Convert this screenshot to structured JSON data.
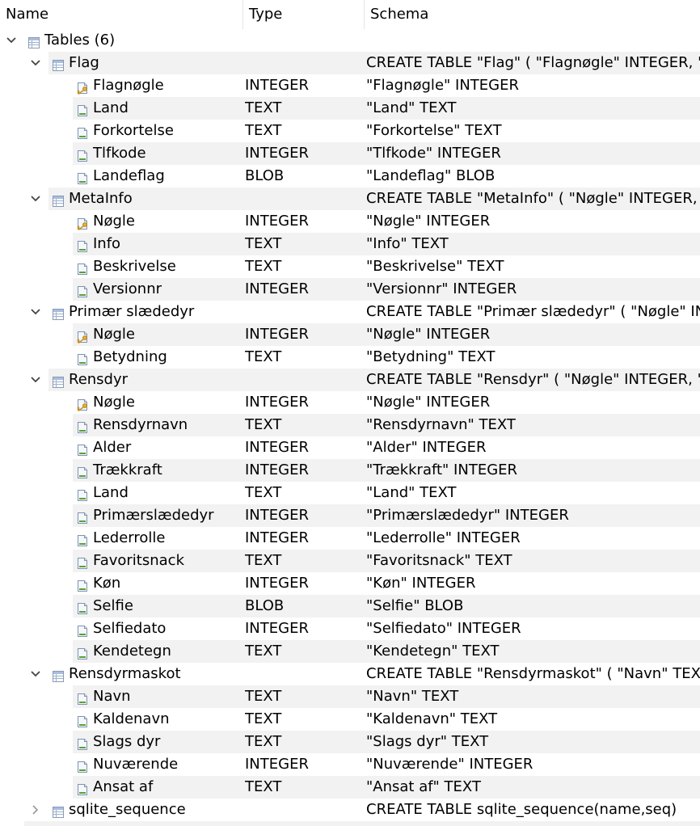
{
  "header": {
    "name": "Name",
    "type": "Type",
    "schema": "Schema"
  },
  "root": {
    "label": "Tables (6)",
    "expanded": true
  },
  "tables": [
    {
      "name": "Flag",
      "expanded": true,
      "schema": "CREATE TABLE \"Flag\" ( \"Flagnøgle\" INTEGER, \"",
      "fields": [
        {
          "name": "Flagnøgle",
          "type": "INTEGER",
          "schema": "\"Flagnøgle\" INTEGER",
          "icon": "primary-key-field-icon"
        },
        {
          "name": "Land",
          "type": "TEXT",
          "schema": "\"Land\" TEXT",
          "icon": "field-icon"
        },
        {
          "name": "Forkortelse",
          "type": "TEXT",
          "schema": "\"Forkortelse\" TEXT",
          "icon": "field-icon"
        },
        {
          "name": "Tlfkode",
          "type": "INTEGER",
          "schema": "\"Tlfkode\" INTEGER",
          "icon": "field-icon"
        },
        {
          "name": "Landeflag",
          "type": "BLOB",
          "schema": "\"Landeflag\" BLOB",
          "icon": "field-icon"
        }
      ]
    },
    {
      "name": "MetaInfo",
      "expanded": true,
      "schema": "CREATE TABLE \"MetaInfo\" ( \"Nøgle\" INTEGER,",
      "fields": [
        {
          "name": "Nøgle",
          "type": "INTEGER",
          "schema": "\"Nøgle\" INTEGER",
          "icon": "primary-key-field-icon"
        },
        {
          "name": "Info",
          "type": "TEXT",
          "schema": "\"Info\" TEXT",
          "icon": "field-icon"
        },
        {
          "name": "Beskrivelse",
          "type": "TEXT",
          "schema": "\"Beskrivelse\" TEXT",
          "icon": "field-icon"
        },
        {
          "name": "Versionnr",
          "type": "INTEGER",
          "schema": "\"Versionnr\" INTEGER",
          "icon": "field-icon"
        }
      ]
    },
    {
      "name": "Primær slædedyr",
      "expanded": true,
      "schema": "CREATE TABLE \"Primær slædedyr\" ( \"Nøgle\" IN",
      "fields": [
        {
          "name": "Nøgle",
          "type": "INTEGER",
          "schema": "\"Nøgle\" INTEGER",
          "icon": "primary-key-field-icon"
        },
        {
          "name": "Betydning",
          "type": "TEXT",
          "schema": "\"Betydning\" TEXT",
          "icon": "field-icon"
        }
      ]
    },
    {
      "name": "Rensdyr",
      "expanded": true,
      "schema": "CREATE TABLE \"Rensdyr\" ( \"Nøgle\" INTEGER, \"",
      "fields": [
        {
          "name": "Nøgle",
          "type": "INTEGER",
          "schema": "\"Nøgle\" INTEGER",
          "icon": "primary-key-field-icon"
        },
        {
          "name": "Rensdyrnavn",
          "type": "TEXT",
          "schema": "\"Rensdyrnavn\" TEXT",
          "icon": "field-icon"
        },
        {
          "name": "Alder",
          "type": "INTEGER",
          "schema": "\"Alder\" INTEGER",
          "icon": "field-icon"
        },
        {
          "name": "Trækkraft",
          "type": "INTEGER",
          "schema": "\"Trækkraft\" INTEGER",
          "icon": "field-icon"
        },
        {
          "name": "Land",
          "type": "TEXT",
          "schema": "\"Land\" TEXT",
          "icon": "field-icon"
        },
        {
          "name": "Primærslædedyr",
          "type": "INTEGER",
          "schema": "\"Primærslædedyr\" INTEGER",
          "icon": "field-icon"
        },
        {
          "name": "Lederrolle",
          "type": "INTEGER",
          "schema": "\"Lederrolle\" INTEGER",
          "icon": "field-icon"
        },
        {
          "name": "Favoritsnack",
          "type": "TEXT",
          "schema": "\"Favoritsnack\" TEXT",
          "icon": "field-icon"
        },
        {
          "name": "Køn",
          "type": "INTEGER",
          "schema": "\"Køn\" INTEGER",
          "icon": "field-icon"
        },
        {
          "name": "Selfie",
          "type": "BLOB",
          "schema": "\"Selfie\" BLOB",
          "icon": "field-icon"
        },
        {
          "name": "Selfiedato",
          "type": "INTEGER",
          "schema": "\"Selfiedato\" INTEGER",
          "icon": "field-icon"
        },
        {
          "name": "Kendetegn",
          "type": "TEXT",
          "schema": "\"Kendetegn\" TEXT",
          "icon": "field-icon"
        }
      ]
    },
    {
      "name": "Rensdyrmaskot",
      "expanded": true,
      "schema": "CREATE TABLE \"Rensdyrmaskot\" ( \"Navn\" TEX",
      "fields": [
        {
          "name": "Navn",
          "type": "TEXT",
          "schema": "\"Navn\" TEXT",
          "icon": "field-icon"
        },
        {
          "name": "Kaldenavn",
          "type": "TEXT",
          "schema": "\"Kaldenavn\" TEXT",
          "icon": "field-icon"
        },
        {
          "name": "Slags dyr",
          "type": "TEXT",
          "schema": "\"Slags dyr\" TEXT",
          "icon": "field-icon"
        },
        {
          "name": "Nuværende",
          "type": "INTEGER",
          "schema": "\"Nuværende\" INTEGER",
          "icon": "field-icon"
        },
        {
          "name": "Ansat af",
          "type": "TEXT",
          "schema": "\"Ansat af\" TEXT",
          "icon": "field-icon"
        }
      ]
    },
    {
      "name": "sqlite_sequence",
      "expanded": false,
      "schema": "CREATE TABLE sqlite_sequence(name,seq)",
      "fields": []
    }
  ]
}
